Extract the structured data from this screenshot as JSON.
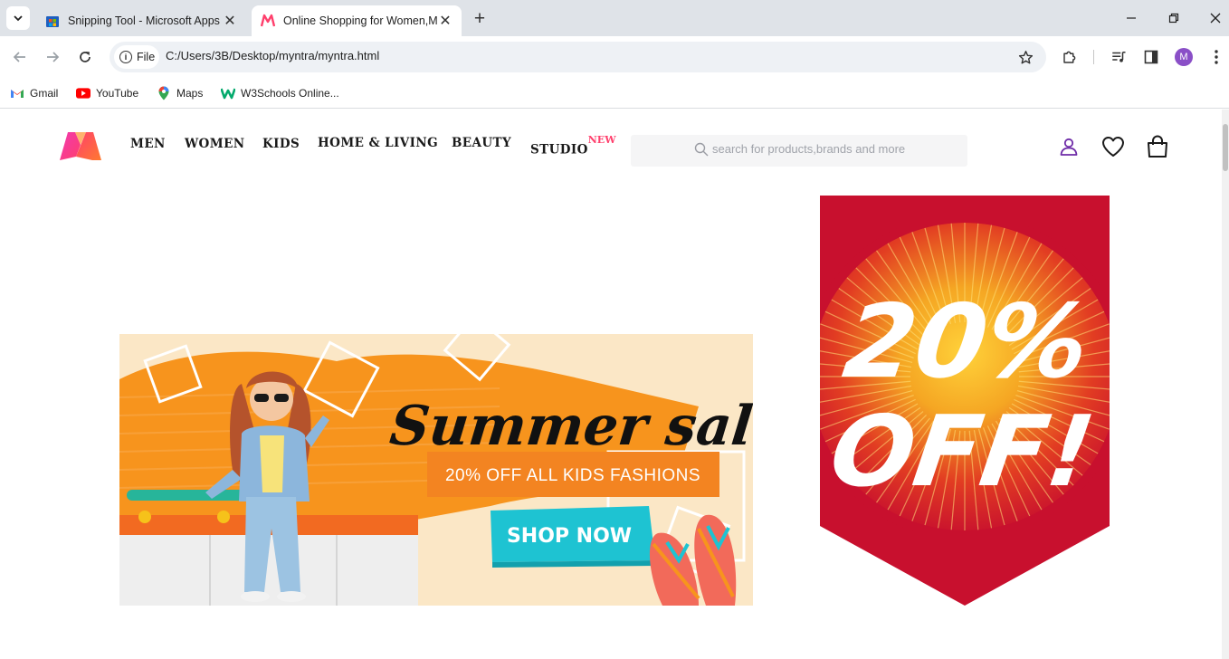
{
  "browser": {
    "tabs": [
      {
        "title": "Snipping Tool - Microsoft Apps",
        "active": false
      },
      {
        "title": "Online Shopping for Women,Men",
        "active": true
      }
    ],
    "site_chip": "File",
    "url": "C:/Users/3B/Desktop/myntra/myntra.html",
    "profile_initial": "M",
    "bookmarks": [
      {
        "label": "Gmail",
        "icon": "gmail-icon"
      },
      {
        "label": "YouTube",
        "icon": "youtube-icon"
      },
      {
        "label": "Maps",
        "icon": "maps-icon"
      },
      {
        "label": "W3Schools Online...",
        "icon": "w3schools-icon"
      }
    ]
  },
  "header": {
    "nav": [
      {
        "label": "MEN"
      },
      {
        "label": "WOMEN"
      },
      {
        "label": "KIDS"
      },
      {
        "label": "HOME & LIVING"
      },
      {
        "label": "BEAUTY"
      },
      {
        "label": "STUDIO",
        "badge": "NEW"
      }
    ],
    "search_placeholder": "search for products,brands and more",
    "icons": [
      "profile-icon",
      "wishlist-icon",
      "bag-icon"
    ]
  },
  "banners": {
    "summer": {
      "headline": "Summer sale.",
      "subline": "20% OFF ALL KIDS FASHIONS",
      "cta": "SHOP NOW"
    },
    "discount": {
      "line1": "20%",
      "line2": "OFF!"
    }
  },
  "colors": {
    "brand_pink": "#ff3f6c",
    "banner_red": "#c8102e",
    "banner_orange": "#f7941d",
    "cta_teal": "#1ec3d2"
  }
}
